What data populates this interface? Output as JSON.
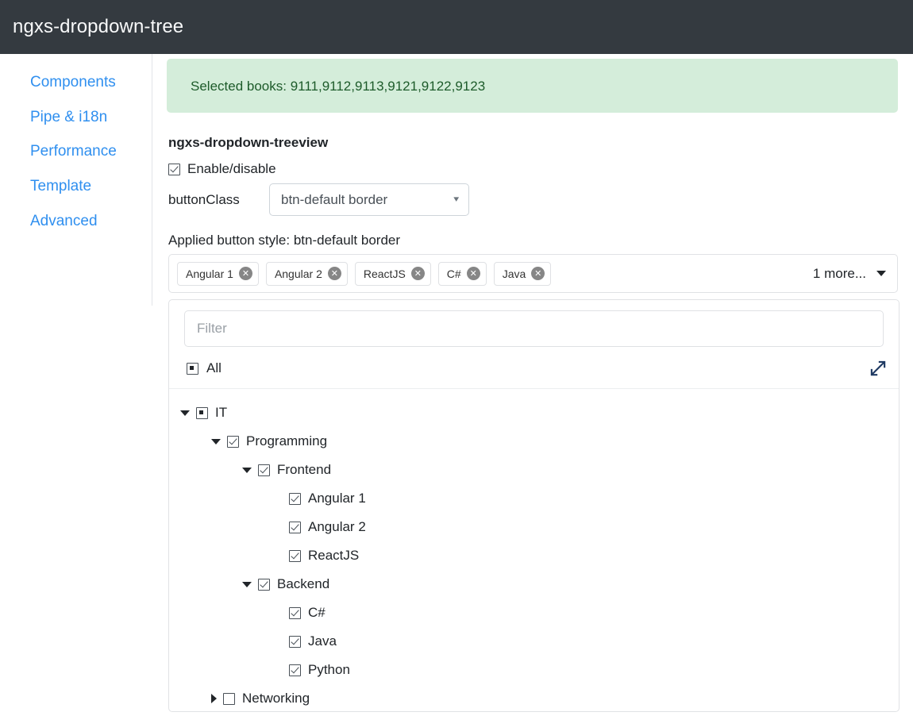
{
  "navbar": {
    "title": "ngxs-dropdown-tree"
  },
  "sidebar": {
    "items": [
      {
        "label": "Components"
      },
      {
        "label": "Pipe & i18n"
      },
      {
        "label": "Performance"
      },
      {
        "label": "Template"
      },
      {
        "label": "Advanced"
      }
    ]
  },
  "alert": {
    "text": "Selected books: 9111,9112,9113,9121,9122,9123",
    "bg_color": "#d4edda",
    "text_color": "#1d5b2a"
  },
  "section": {
    "title": "ngxs-dropdown-treeview",
    "enable_checkbox": {
      "label": "Enable/disable",
      "state": "checked"
    },
    "button_class": {
      "label": "buttonClass",
      "value": "btn-default border",
      "caret_icon": "chevron-down-icon"
    },
    "applied_style": "Applied button style: btn-default border"
  },
  "dropdown": {
    "chips": [
      {
        "label": "Angular 1",
        "remove_icon": "close-circle-icon"
      },
      {
        "label": "Angular 2",
        "remove_icon": "close-circle-icon"
      },
      {
        "label": "ReactJS",
        "remove_icon": "close-circle-icon"
      },
      {
        "label": "C#",
        "remove_icon": "close-circle-icon"
      },
      {
        "label": "Java",
        "remove_icon": "close-circle-icon"
      }
    ],
    "more_label": "1 more...",
    "caret_icon": "triangle-down-icon"
  },
  "treeview": {
    "filter": {
      "placeholder": "Filter",
      "value": ""
    },
    "all": {
      "label": "All",
      "state": "indeterminate"
    },
    "expand_icon": "expand-arrows-icon",
    "nodes": [
      {
        "label": "IT",
        "state": "indeterminate",
        "caret": "open",
        "depth": 0
      },
      {
        "label": "Programming",
        "state": "checked",
        "caret": "open",
        "depth": 1
      },
      {
        "label": "Frontend",
        "state": "checked",
        "caret": "open",
        "depth": 2
      },
      {
        "label": "Angular 1",
        "state": "checked",
        "caret": "none",
        "depth": 3
      },
      {
        "label": "Angular 2",
        "state": "checked",
        "caret": "none",
        "depth": 3
      },
      {
        "label": "ReactJS",
        "state": "checked",
        "caret": "none",
        "depth": 3
      },
      {
        "label": "Backend",
        "state": "checked",
        "caret": "open",
        "depth": 2
      },
      {
        "label": "C#",
        "state": "checked",
        "caret": "none",
        "depth": 3
      },
      {
        "label": "Java",
        "state": "checked",
        "caret": "none",
        "depth": 3
      },
      {
        "label": "Python",
        "state": "checked",
        "caret": "none",
        "depth": 3
      },
      {
        "label": "Networking",
        "state": "unchecked",
        "caret": "closed",
        "depth": 1
      }
    ]
  },
  "colors": {
    "navbar_bg": "#343a40",
    "link": "#2f8fef",
    "border": "#e0e2e5"
  }
}
